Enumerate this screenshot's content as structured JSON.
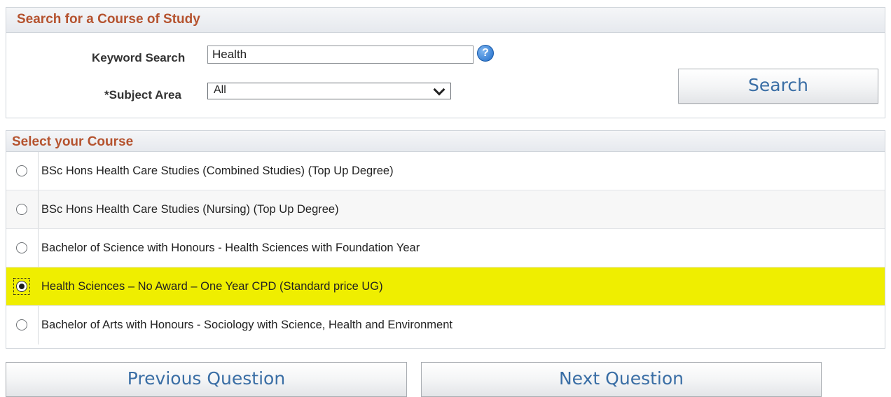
{
  "search_panel": {
    "title": "Search for a Course of Study",
    "keyword_label": "Keyword Search",
    "keyword_value": "Health",
    "subject_label": "*Subject Area",
    "subject_selected": "All",
    "search_button": "Search",
    "help_icon": "?"
  },
  "course_panel": {
    "title": "Select your Course",
    "courses": [
      {
        "label": "BSc Hons Health Care Studies (Combined Studies) (Top Up Degree)",
        "selected": false
      },
      {
        "label": "BSc Hons Health Care Studies (Nursing) (Top Up Degree)",
        "selected": false
      },
      {
        "label": "Bachelor of Science with Honours - Health Sciences with Foundation Year",
        "selected": false
      },
      {
        "label": "Health Sciences – No Award – One Year CPD (Standard price UG)",
        "selected": true
      },
      {
        "label": "Bachelor of Arts with Honours - Sociology with Science, Health and Environment",
        "selected": false
      }
    ]
  },
  "navigation": {
    "previous_label": "Previous Question",
    "next_label": "Next Question"
  },
  "colors": {
    "header_text": "#b5532f",
    "button_text": "#3a6ea5",
    "selected_row": "#efee00"
  }
}
